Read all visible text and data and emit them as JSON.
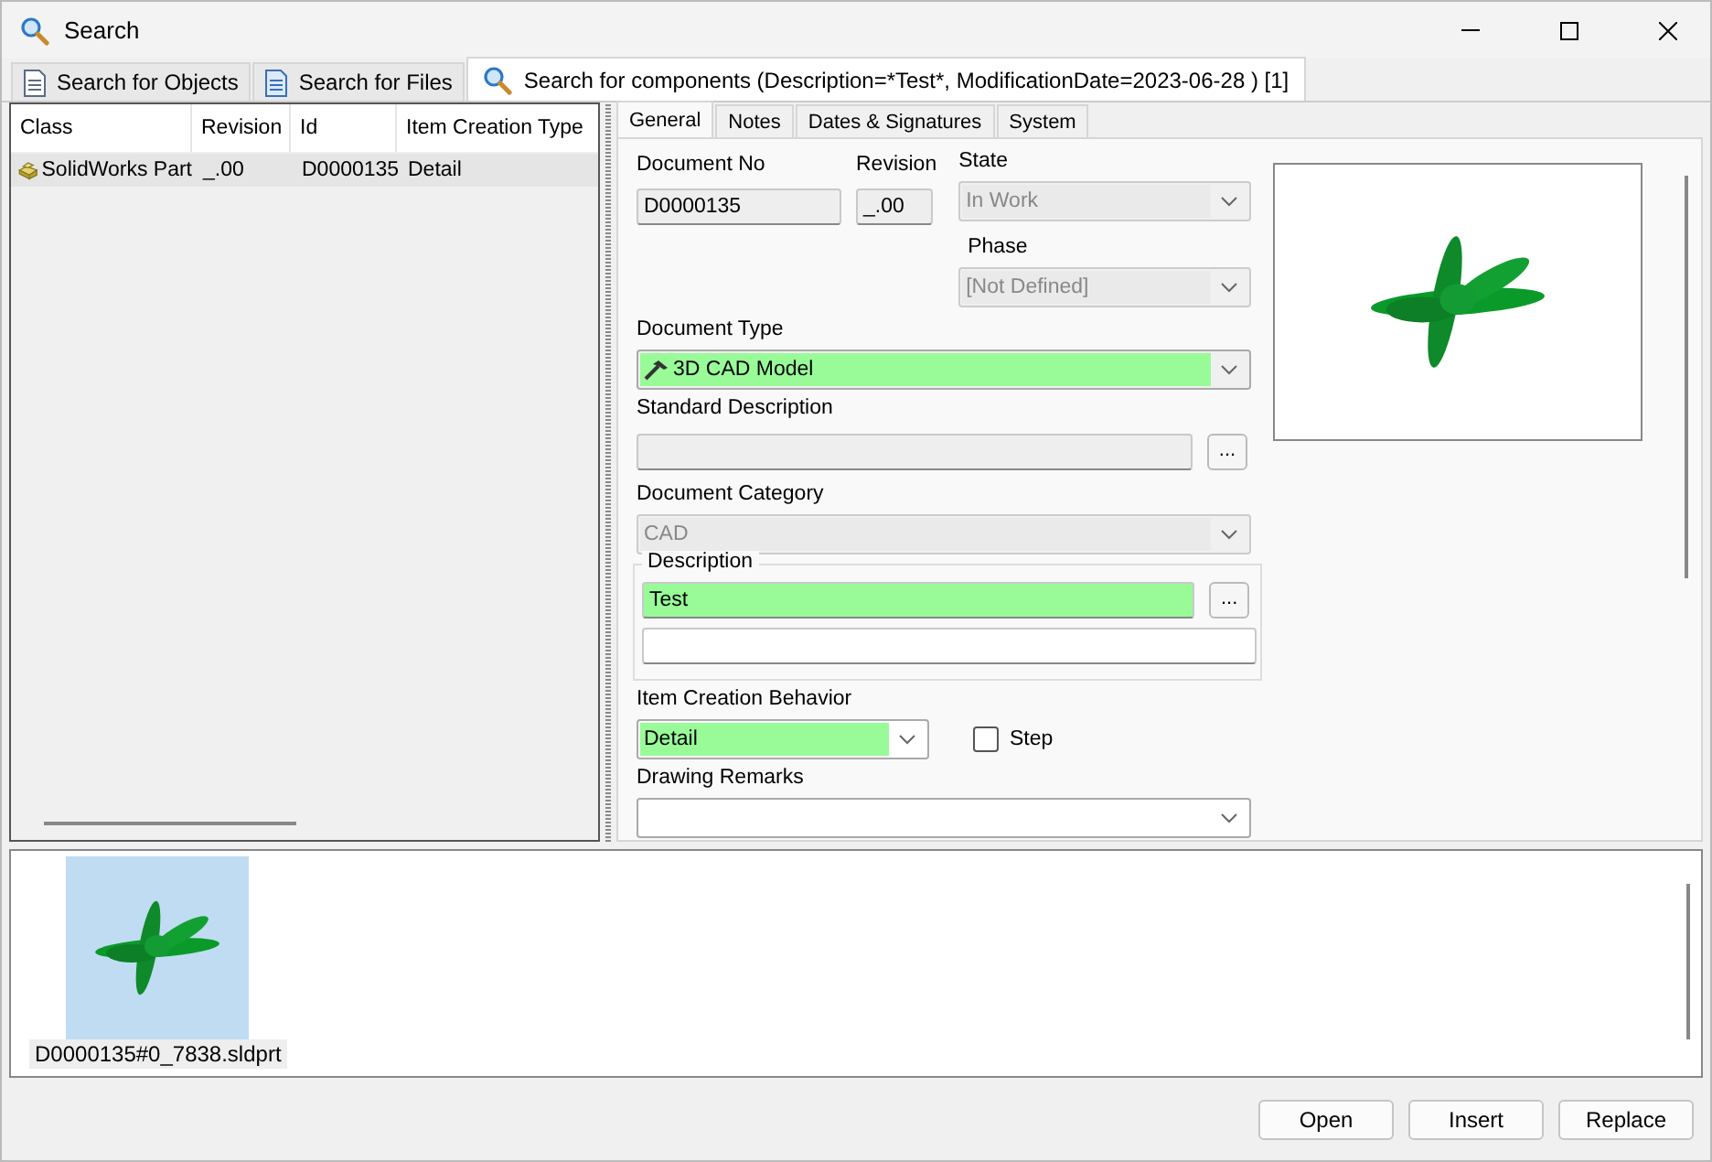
{
  "window": {
    "title": "Search"
  },
  "tabs": [
    {
      "label": "Search for Objects",
      "kind": "document",
      "selected": false
    },
    {
      "label": "Search for Files",
      "kind": "file",
      "selected": false
    },
    {
      "label": "Search for components (Description=*Test*, ModificationDate=2023-06-28 ) [1]",
      "kind": "search",
      "selected": true
    }
  ],
  "results_table": {
    "columns": [
      "Class",
      "Revision",
      "Id",
      "Item Creation Type"
    ],
    "rows": [
      {
        "cells": [
          "SolidWorks Part",
          "_.00",
          "D0000135",
          "Detail"
        ],
        "selected": true
      }
    ]
  },
  "detail_tabs": [
    {
      "label": "General",
      "selected": true
    },
    {
      "label": "Notes",
      "selected": false
    },
    {
      "label": "Dates & Signatures",
      "selected": false
    },
    {
      "label": "System",
      "selected": false
    }
  ],
  "form": {
    "document_no": {
      "label": "Document No",
      "value": "D0000135"
    },
    "revision": {
      "label": "Revision",
      "value": "_.00"
    },
    "state": {
      "label": "State",
      "value": "In Work",
      "disabled": true
    },
    "phase": {
      "label": "Phase",
      "value": "[Not Defined]",
      "disabled": true
    },
    "document_type": {
      "label": "Document Type",
      "value": "3D CAD Model",
      "highlighted": true
    },
    "standard_description": {
      "label": "Standard Description",
      "button": "..."
    },
    "document_category": {
      "label": "Document Category",
      "value": "CAD",
      "disabled": true
    },
    "description": {
      "label": "Description",
      "value": "Test",
      "highlighted": true,
      "button": "..."
    },
    "item_creation_behavior": {
      "label": "Item Creation Behavior",
      "value": "Detail",
      "highlighted": true
    },
    "step": {
      "label": "Step",
      "checked": false
    },
    "drawing_remarks": {
      "label": "Drawing Remarks"
    }
  },
  "thumbnails": [
    {
      "caption": "D0000135#0_7838.sldprt",
      "selected": true
    }
  ],
  "buttons": [
    "Open",
    "Insert",
    "Replace"
  ]
}
